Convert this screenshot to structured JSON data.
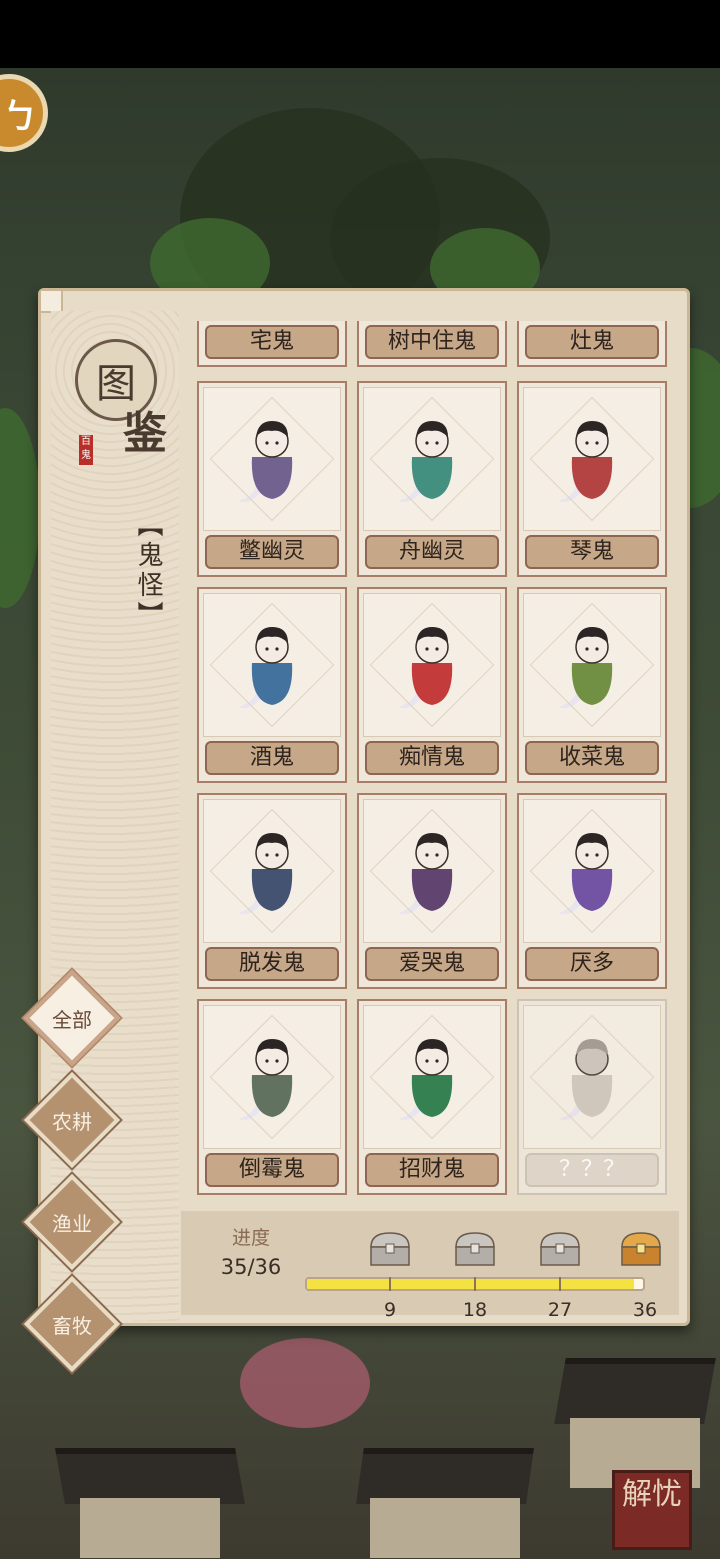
{
  "scene": {
    "corner_badge": "解忧",
    "top_left_icon": "stamp-icon"
  },
  "codex": {
    "title_1": "图",
    "title_2": "鉴",
    "stamp": "百鬼",
    "category": "【鬼怪】",
    "cards": [
      {
        "name": "宅鬼",
        "icon": "house-ghost-icon",
        "color": "#6a5a4a"
      },
      {
        "name": "树中住鬼",
        "icon": "tree-ghost-icon",
        "color": "#5a7a4a"
      },
      {
        "name": "灶鬼",
        "icon": "stove-ghost-icon",
        "color": "#8a5a3a"
      },
      {
        "name": "鳖幽灵",
        "icon": "turtle-ghost-icon",
        "color": "#6a5a8a"
      },
      {
        "name": "舟幽灵",
        "icon": "boat-ghost-icon",
        "color": "#3a8a7a"
      },
      {
        "name": "琴鬼",
        "icon": "zither-ghost-icon",
        "color": "#b03a3a"
      },
      {
        "name": "酒鬼",
        "icon": "wine-ghost-icon",
        "color": "#3a6a9a"
      },
      {
        "name": "痴情鬼",
        "icon": "umbrella-ghost-icon",
        "color": "#c03030"
      },
      {
        "name": "收菜鬼",
        "icon": "farmer-ghost-icon",
        "color": "#6a8a3a"
      },
      {
        "name": "脱发鬼",
        "icon": "bald-ghost-icon",
        "color": "#3a4a6a"
      },
      {
        "name": "爱哭鬼",
        "icon": "crying-ghost-icon",
        "color": "#5a3a6a"
      },
      {
        "name": "厌多",
        "icon": "rabbit-ghost-icon",
        "color": "#6a4aa0"
      },
      {
        "name": "倒霉鬼",
        "icon": "unlucky-ghost-icon",
        "color": "#5a6a5a"
      },
      {
        "name": "招财鬼",
        "icon": "fortune-ghost-icon",
        "color": "#2a7a4a"
      },
      {
        "name": "？？？",
        "icon": "locked-ghost-icon",
        "color": "#b0a8a0",
        "locked": true
      }
    ],
    "tabs": [
      "全部",
      "农耕",
      "渔业",
      "畜牧"
    ],
    "active_tab": "全部",
    "progress": {
      "label": "进度",
      "count": "35/36",
      "value": 35,
      "max": 36,
      "milestones": [
        "9",
        "18",
        "27",
        "36"
      ],
      "chest_icons": [
        "gray-chest-icon",
        "gray-chest-icon",
        "gray-chest-icon",
        "gold-chest-icon"
      ]
    }
  }
}
